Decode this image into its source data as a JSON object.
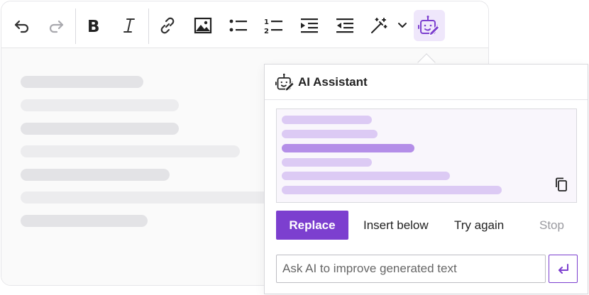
{
  "toolbar": {
    "buttons": [
      {
        "name": "undo-icon"
      },
      {
        "name": "redo-icon"
      },
      {
        "name": "bold-icon"
      },
      {
        "name": "italic-icon"
      },
      {
        "name": "link-icon"
      },
      {
        "name": "image-icon"
      },
      {
        "name": "bulleted-list-icon"
      },
      {
        "name": "numbered-list-icon"
      },
      {
        "name": "increase-indent-icon"
      },
      {
        "name": "decrease-indent-icon"
      },
      {
        "name": "magic-wand-icon"
      },
      {
        "name": "chevron-down-icon"
      },
      {
        "name": "ai-robot-icon"
      }
    ],
    "active_button": "ai-assistant",
    "accent_color": "#7c3fcf"
  },
  "popover": {
    "title": "AI Assistant",
    "actions": {
      "replace": "Replace",
      "insert_below": "Insert below",
      "try_again": "Try again",
      "stop": "Stop"
    },
    "input": {
      "placeholder": "Ask AI to improve generated text",
      "value": ""
    }
  }
}
